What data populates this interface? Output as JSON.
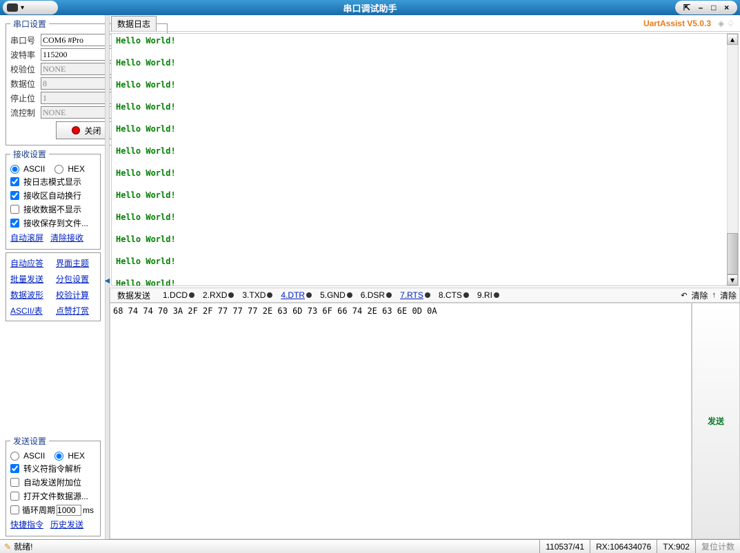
{
  "title": "串口调试助手",
  "window_controls": {
    "pin": "⇱",
    "min": "–",
    "max": "□",
    "close": "×"
  },
  "brand": "UartAssist V5.0.3",
  "log_tab": "数据日志",
  "port_settings": {
    "legend": "串口设置",
    "port_label": "串口号",
    "port_value": "COM6 #Pro",
    "baud_label": "波特率",
    "baud_value": "115200",
    "parity_label": "校验位",
    "parity_value": "NONE",
    "data_label": "数据位",
    "data_value": "8",
    "stop_label": "停止位",
    "stop_value": "1",
    "flow_label": "流控制",
    "flow_value": "NONE",
    "close_btn": "关闭"
  },
  "recv_settings": {
    "legend": "接收设置",
    "ascii": "ASCII",
    "hex": "HEX",
    "opt1": "按日志模式显示",
    "opt2": "接收区自动换行",
    "opt3": "接收数据不显示",
    "opt4": "接收保存到文件...",
    "link1": "自动滚屏",
    "link2": "清除接收"
  },
  "tool_links": {
    "a1": "自动应答",
    "a2": "界面主题",
    "b1": "批量发送",
    "b2": "分包设置",
    "c1": "数据波形",
    "c2": "校验计算",
    "d1": "ASCII/表",
    "d2": "点赞打赏"
  },
  "send_settings": {
    "legend": "发送设置",
    "ascii": "ASCII",
    "hex": "HEX",
    "opt1": "转义符指令解析",
    "opt2": "自动发送附加位",
    "opt3": "打开文件数据源...",
    "period_label": "循环周期",
    "period_value": "1000",
    "period_unit": "ms",
    "link1": "快捷指令",
    "link2": "历史发送"
  },
  "log_lines": "Hello World!\n\nHello World!\n\nHello World!\n\nHello World!\n\nHello World!\n\nHello World!\n\nHello World!\n\nHello World!\n\nHello World!\n\nHello World!\n\nHello World!\n\nHello World!\n\nHello World!\n\nHello World!\n\nHello World!\n\nHello World!\n\nHello World!\n\nHello World!\n\nH",
  "send_header": {
    "tab": "数据发送",
    "pins": [
      {
        "lbl": "1.DCD",
        "link": false
      },
      {
        "lbl": "2.RXD",
        "link": false
      },
      {
        "lbl": "3.TXD",
        "link": false
      },
      {
        "lbl": "4.DTR",
        "link": true
      },
      {
        "lbl": "5.GND",
        "link": false
      },
      {
        "lbl": "6.DSR",
        "link": false
      },
      {
        "lbl": "7.RTS",
        "link": true
      },
      {
        "lbl": "8.CTS",
        "link": false
      },
      {
        "lbl": "9.RI",
        "link": false
      }
    ],
    "clear1": "清除",
    "clear2": "清除"
  },
  "send_input": "68 74 74 70 3A 2F 2F 77 77 77 2E 63 6D 73 6F 66 74 2E 63 6E 0D 0A",
  "send_btn": "发送",
  "status": {
    "ready": "就绪!",
    "s1": "110537/41",
    "s2": "RX:106434076",
    "s3": "TX:902",
    "reset": "复位计数"
  }
}
